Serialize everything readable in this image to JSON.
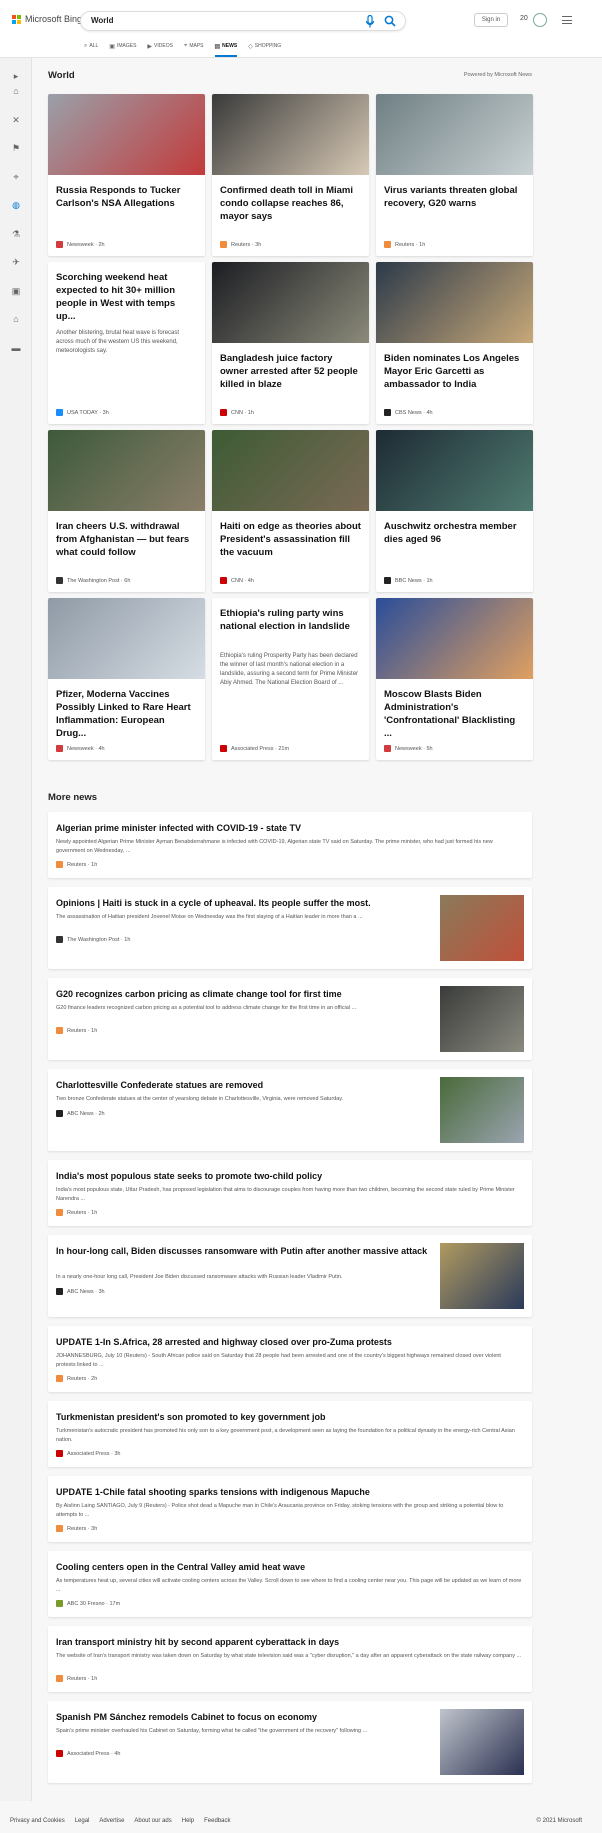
{
  "header": {
    "brand": "Microsoft Bing",
    "query": "World",
    "signin": "Sign in",
    "points": "20",
    "tabs": [
      {
        "label": "ALL",
        "icon": "search-icon"
      },
      {
        "label": "IMAGES",
        "icon": "images-icon"
      },
      {
        "label": "VIDEOS",
        "icon": "videos-icon"
      },
      {
        "label": "MAPS",
        "icon": "map-pin-icon"
      },
      {
        "label": "NEWS",
        "icon": "news-icon",
        "active": true
      },
      {
        "label": "SHOPPING",
        "icon": "shopping-tag-icon"
      }
    ]
  },
  "rail_icons": [
    "chevron-right-icon",
    "home-icon",
    "sports-icon",
    "flag-icon",
    "location-icon",
    "globe-icon",
    "science-icon",
    "technology-icon",
    "entertainment-icon",
    "business-icon",
    "politics-icon"
  ],
  "section": {
    "title": "World",
    "powered": "Powered by Microsoft News"
  },
  "cards": [
    {
      "title": "Russia Responds to Tucker Carlson's NSA Allegations",
      "source": "Newsweek · 2h",
      "src_color": "#d23c3c",
      "img": [
        "#9aa0aa",
        "#c23b3b"
      ]
    },
    {
      "title": "Confirmed death toll in Miami condo collapse reaches 86, mayor says",
      "source": "Reuters · 3h",
      "src_color": "#f08c3c",
      "img": [
        "#3a3a3a",
        "#d7c9b5"
      ]
    },
    {
      "title": "Virus variants threaten global recovery, G20 warns",
      "source": "Reuters · 1h",
      "src_color": "#f08c3c",
      "img": [
        "#6f7f83",
        "#c9d1d3"
      ]
    },
    {
      "title": "Scorching weekend heat expected to hit 30+ million people in West with temps up...",
      "desc": "Another blistering, brutal heat wave is forecast across much of the western US this weekend, meteorologists say.",
      "source": "USA TODAY · 3h",
      "src_color": "#1a8cff",
      "img": null
    },
    {
      "title": "Bangladesh juice factory owner arrested after 52 people killed in blaze",
      "source": "CNN · 1h",
      "src_color": "#cc0000",
      "img": [
        "#1b1d22",
        "#8b8a7a"
      ]
    },
    {
      "title": "Biden nominates Los Angeles Mayor Eric Garcetti as ambassador to India",
      "source": "CBS News · 4h",
      "src_color": "#222222",
      "img": [
        "#2c3a4a",
        "#c8a878"
      ]
    },
    {
      "title": "Iran cheers U.S. withdrawal from Afghanistan — but fears what could follow",
      "source": "The Washington Post · 6h",
      "src_color": "#333333",
      "img": [
        "#3d5a3a",
        "#8a7e6a"
      ]
    },
    {
      "title": "Haiti on edge as theories about President's assassination fill the vacuum",
      "source": "CNN · 4h",
      "src_color": "#cc0000",
      "img": [
        "#3d5b35",
        "#7a6a55"
      ]
    },
    {
      "title": "Auschwitz orchestra member dies aged 96",
      "source": "BBC News · 1h",
      "src_color": "#222222",
      "img": [
        "#1e2b34",
        "#4f7a70"
      ]
    },
    {
      "title": "Pfizer, Moderna Vaccines Possibly Linked to Rare Heart Inflammation: European Drug...",
      "source": "Newsweek · 4h",
      "src_color": "#d23c3c",
      "img": [
        "#8f9aa6",
        "#d6dde4"
      ]
    },
    {
      "title": "Ethiopia's ruling party wins national election in landslide",
      "desc": "Ethiopia's ruling Prosperity Party has been declared the winner of last month's national election in a landslide, assuring a second term for Prime Minister Abiy Ahmed. The National Election Board of ...",
      "source": "Associated Press · 21m",
      "src_color": "#cc0000",
      "img": null
    },
    {
      "title": "Moscow Blasts Biden Administration's 'Confrontational' Blacklisting ...",
      "source": "Newsweek · 5h",
      "src_color": "#d23c3c",
      "img": [
        "#2a4d9a",
        "#e0a060"
      ]
    }
  ],
  "more_news_title": "More news",
  "more_news": [
    {
      "title": "Algerian prime minister infected with COVID-19 - state TV",
      "desc": "Newly appointed Algerian Prime Minister Ayman Benabderrahmane is infected with COVID-19, Algerian state TV said on Saturday. The prime minister, who had just formed his new government on Wednesday, ...",
      "source": "Reuters · 1h",
      "src_color": "#f08c3c",
      "img": null
    },
    {
      "title": "Opinions | Haiti is stuck in a cycle of upheaval. Its people suffer the most.",
      "desc": "The assassination of Haitian president Jovenel Moise on Wednesday was the first slaying of a Haitian leader in more than a ...",
      "source": "The Washington Post · 1h",
      "src_color": "#333333",
      "img": [
        "#8a7a5a",
        "#c0503a"
      ]
    },
    {
      "title": "G20 recognizes carbon pricing as climate change tool for first time",
      "desc": "G20 finance leaders recognized carbon pricing as a potential tool to address climate change for the first time in an official ...",
      "source": "Reuters · 1h",
      "src_color": "#f08c3c",
      "img": [
        "#3a3c3a",
        "#8a8a80"
      ]
    },
    {
      "title": "Charlottesville Confederate statues are removed",
      "desc": "Two bronze Confederate statues at the center of yearslong debate in Charlottesville, Virginia, were removed Saturday.",
      "source": "ABC News · 2h",
      "src_color": "#222222",
      "img": [
        "#4a6a3a",
        "#9aa4b0"
      ]
    },
    {
      "title": "India's most populous state seeks to promote two-child policy",
      "desc": "India's most populous state, Uttar Pradesh, has proposed legislation that aims to discourage couples from having more than two children, becoming the second state ruled by Prime Minister Narendra ...",
      "source": "Reuters · 1h",
      "src_color": "#f08c3c",
      "img": null
    },
    {
      "title": "In hour-long call, Biden discusses ransomware with Putin after another massive attack",
      "desc": "In a nearly one-hour long call, President Joe Biden discussed ransomware attacks with Russian leader Vladimir Putin.",
      "source": "ABC News · 3h",
      "src_color": "#222222",
      "img": [
        "#b09a60",
        "#2a3a5a"
      ]
    },
    {
      "title": "UPDATE 1-In S.Africa, 28 arrested and highway closed over pro-Zuma protests",
      "desc": "JOHANNESBURG, July 10 (Reuters) - South African police said on Saturday that 28 people had been arrested and one of the country's biggest highways remained closed over violent protests linked to ...",
      "source": "Reuters · 2h",
      "src_color": "#f08c3c",
      "img": null
    },
    {
      "title": "Turkmenistan president's son promoted to key government job",
      "desc": "Turkmenistan's autocratic president has promoted his only son to a key government post, a development seen as laying the foundation for a political dynasty in the energy-rich Central Asian nation.",
      "source": "Associated Press · 3h",
      "src_color": "#cc0000",
      "img": null
    },
    {
      "title": "UPDATE 1-Chile fatal shooting sparks tensions with indigenous Mapuche",
      "desc": "By Aislinn Laing SANTIAGO, July 9 (Reuters) - Police shot dead a Mapuche man in Chile's Araucania province on Friday, stoking tensions with the group and striking a potential blow to attempts to ...",
      "source": "Reuters · 3h",
      "src_color": "#f08c3c",
      "img": null
    },
    {
      "title": "Cooling centers open in the Central Valley amid heat wave",
      "desc": "As temperatures heat up, several cities will activate cooling centers across the Valley. Scroll down to see where to find a cooling center near you. This page will be updated as we learn of more ...",
      "source": "ABC 30 Fresno · 17m",
      "src_color": "#7a9a2a",
      "img": null
    },
    {
      "title": "Iran transport ministry hit by second apparent cyberattack in days",
      "desc": "The website of Iran's transport ministry was taken down on Saturday by what state television said was a \"cyber disruption,\" a day after an apparent cyberattack on the state railway company ...",
      "source": "Reuters · 1h",
      "src_color": "#f08c3c",
      "img": null
    },
    {
      "title": "Spanish PM Sánchez remodels Cabinet to focus on economy",
      "desc": "Spain's prime minister overhauled his Cabinet on Saturday, forming what he called \"the government of the recovery\" following ...",
      "source": "Associated Press · 4h",
      "src_color": "#cc0000",
      "img": [
        "#c0c4cc",
        "#2a3050"
      ]
    }
  ],
  "footer": {
    "links": [
      "Privacy and Cookies",
      "Legal",
      "Advertise",
      "About our ads",
      "Help",
      "Feedback"
    ],
    "copyright": "© 2021 Microsoft"
  }
}
